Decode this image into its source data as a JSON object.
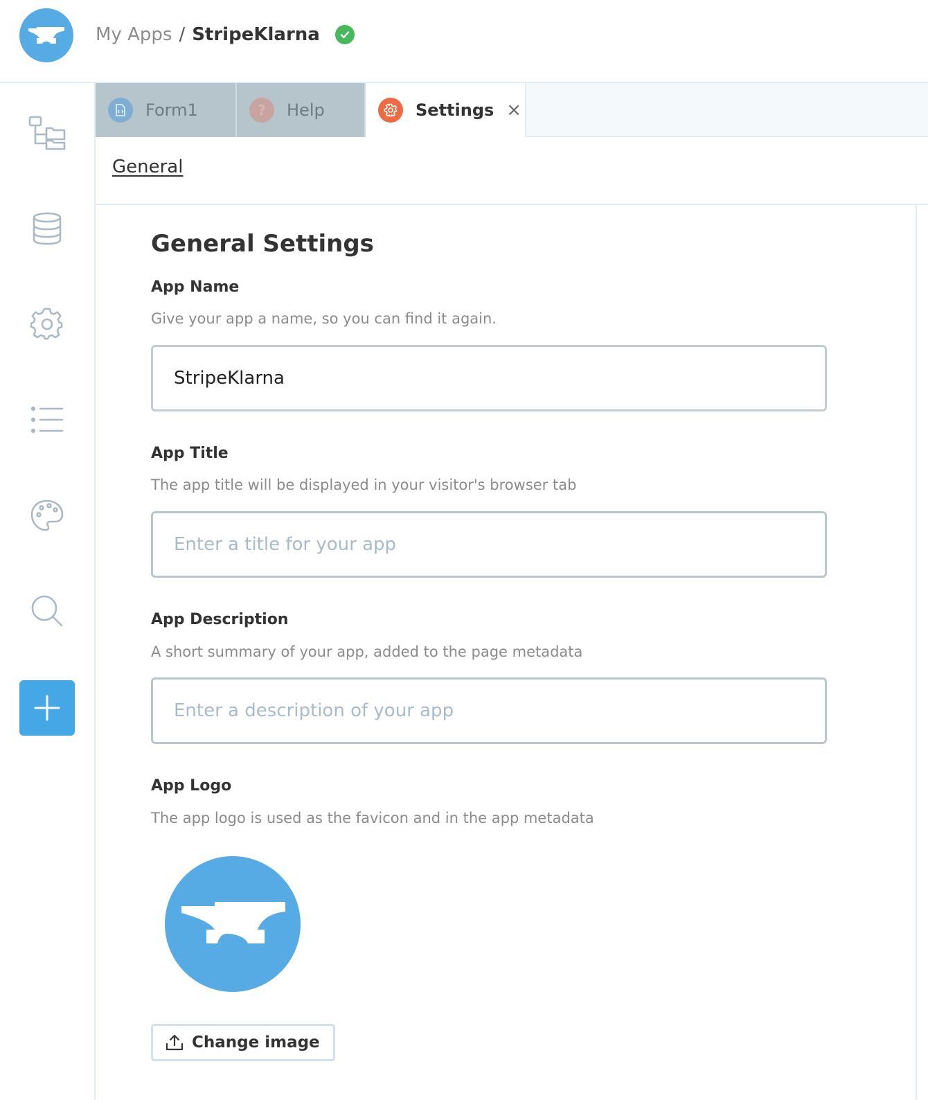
{
  "header": {
    "breadcrumb_root": "My Apps",
    "breadcrumb_separator": "/",
    "app_name": "StripeKlarna",
    "status": "saved"
  },
  "sidebar": {
    "items": [
      {
        "name": "app-tree",
        "icon": "folder-tree-icon"
      },
      {
        "name": "data",
        "icon": "database-icon"
      },
      {
        "name": "settings",
        "icon": "gear-icon"
      },
      {
        "name": "list",
        "icon": "list-icon"
      },
      {
        "name": "theme",
        "icon": "palette-icon"
      },
      {
        "name": "search",
        "icon": "search-icon"
      }
    ],
    "add_icon": "plus-icon"
  },
  "tabs": [
    {
      "label": "Form1",
      "icon": "form-icon",
      "active": false
    },
    {
      "label": "Help",
      "icon": "help-icon",
      "active": false
    },
    {
      "label": "Settings",
      "icon": "gear-icon",
      "active": true,
      "closable": true,
      "close_glyph": "×"
    }
  ],
  "subnav": {
    "link": "General"
  },
  "main": {
    "title": "General Settings",
    "app_name": {
      "label": "App Name",
      "help": "Give your app a name, so you can find it again.",
      "value": "StripeKlarna"
    },
    "app_title": {
      "label": "App Title",
      "help": "The app title will be displayed in your visitor's browser tab",
      "placeholder": "Enter a title for your app"
    },
    "app_description": {
      "label": "App Description",
      "help": "A short summary of your app, added to the page metadata",
      "placeholder": "Enter a description of your app"
    },
    "app_logo": {
      "label": "App Logo",
      "help": "The app logo is used as the favicon and in the app metadata",
      "button_label": "Change image"
    }
  },
  "colors": {
    "brand_blue": "#56abe4",
    "add_button": "#45a7e6",
    "status_green": "#47b85c",
    "settings_tab_icon": "#ee6a43",
    "inactive_tab": "#b6c4cc",
    "input_border": "#b8c6ce",
    "help_text": "#8b8b8b"
  }
}
